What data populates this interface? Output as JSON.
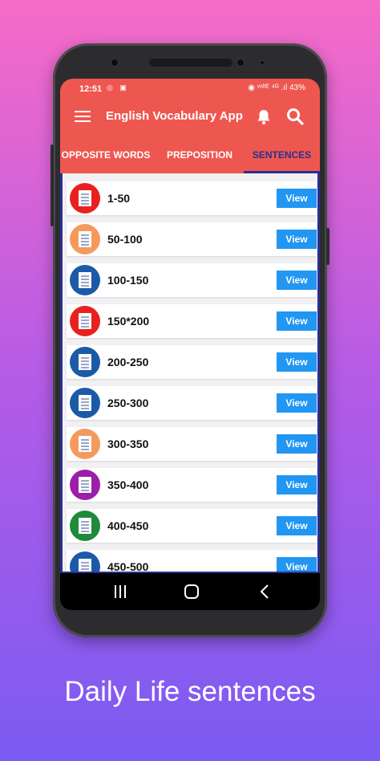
{
  "status": {
    "time": "12:51",
    "left_icons": "◎ ▣",
    "right_text": "◉ ᵛᵒˡᵗᴱ ⁴ᴳ .ıl 43%"
  },
  "appbar": {
    "title": "English Vocabulary App"
  },
  "tabs": [
    {
      "label": "OPPOSITE WORDS",
      "active": false
    },
    {
      "label": "PREPOSITION",
      "active": false
    },
    {
      "label": "SENTENCES",
      "active": true
    }
  ],
  "rows": [
    {
      "label": "1-50",
      "color": "#e8211f",
      "button": "View"
    },
    {
      "label": "50-100",
      "color": "#f59a5d",
      "button": "View"
    },
    {
      "label": "100-150",
      "color": "#1b5aa6",
      "button": "View"
    },
    {
      "label": "150*200",
      "color": "#e8211f",
      "button": "View"
    },
    {
      "label": "200-250",
      "color": "#1b5aa6",
      "button": "View"
    },
    {
      "label": "250-300",
      "color": "#1b5aa6",
      "button": "View"
    },
    {
      "label": "300-350",
      "color": "#f59a5d",
      "button": "View"
    },
    {
      "label": "350-400",
      "color": "#9b1fa8",
      "button": "View"
    },
    {
      "label": "400-450",
      "color": "#1f8a3a",
      "button": "View"
    },
    {
      "label": "450-500",
      "color": "#1b5aa6",
      "button": "View"
    }
  ],
  "colors": {
    "appbar": "#ee5750",
    "accent": "#2b2f8f",
    "button": "#2196f3"
  },
  "caption": "Daily Life sentences"
}
